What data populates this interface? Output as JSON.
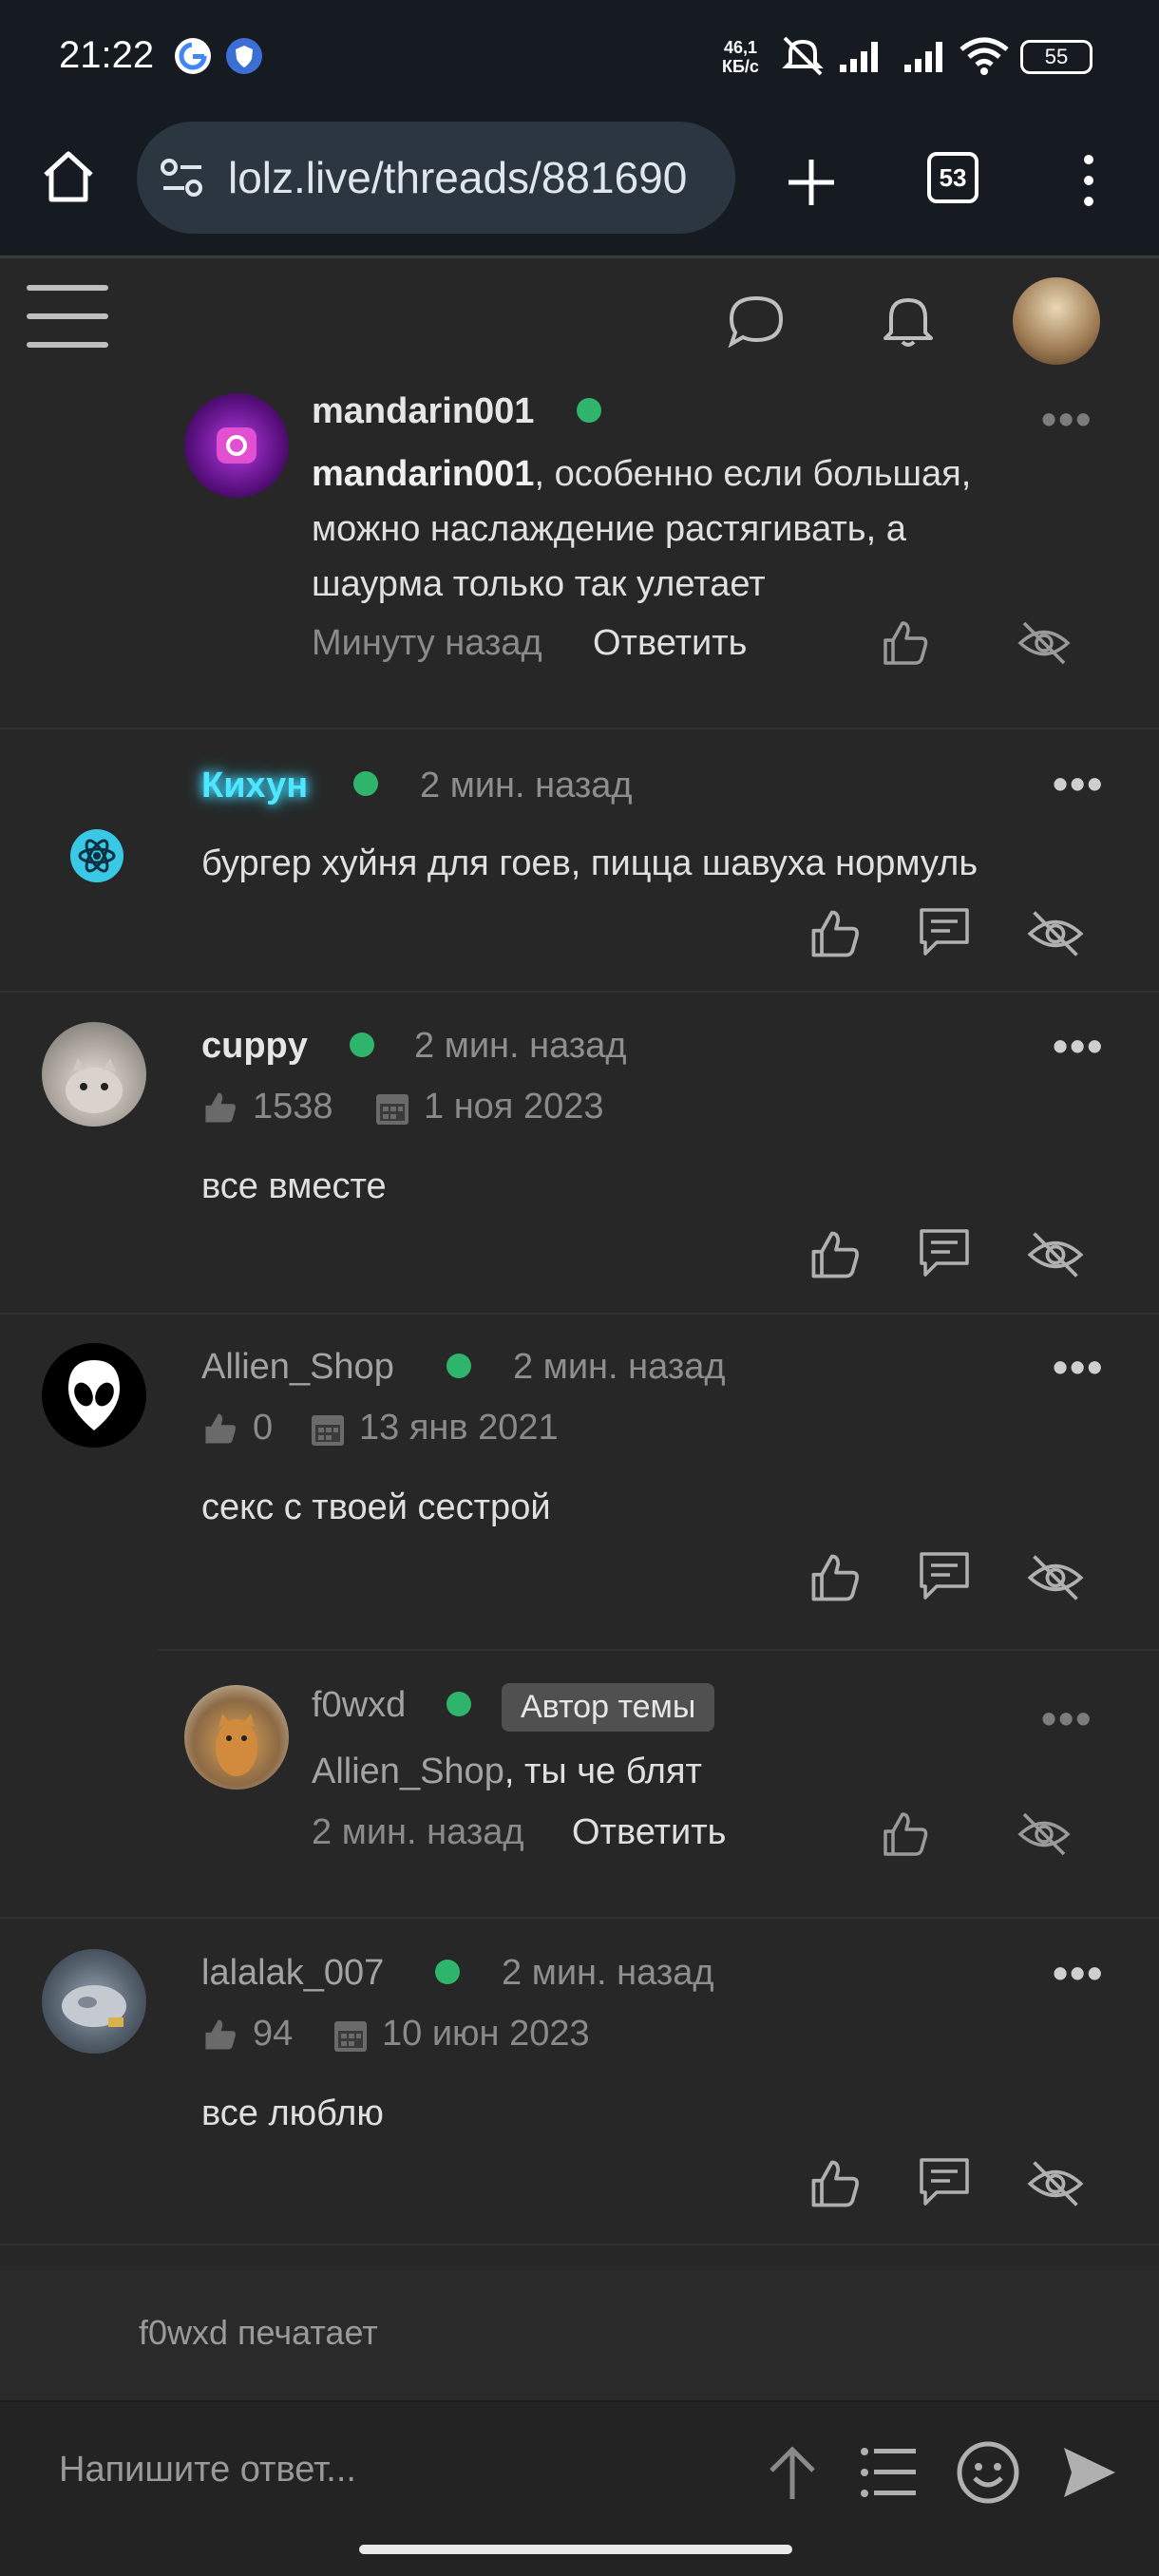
{
  "status_bar": {
    "time": "21:22",
    "net_speed_value": "46,1",
    "net_speed_unit": "КБ/с",
    "battery": "55"
  },
  "browser": {
    "url": "lolz.live/threads/881690",
    "tab_count": "53"
  },
  "comments": [
    {
      "username": "mandarin001",
      "mention": "mandarin001",
      "text_line1": ", особенно если большая,",
      "text_line2": "можно наслаждение растягивать, а",
      "text_line3": "шаурма только так улетает",
      "time": "Минуту назад",
      "reply_label": "Ответить"
    },
    {
      "username": "Кихун",
      "time": "2 мин. назад",
      "text": "бургер хуйня для гоев, пицца шавуха нормуль"
    },
    {
      "username": "cuppy",
      "time": "2 мин. назад",
      "likes": "1538",
      "joined": "1 ноя 2023",
      "text": "все вместе"
    },
    {
      "username": "Allien_Shop",
      "time": "2 мин. назад",
      "likes": "0",
      "joined": "13 янв 2021",
      "text": "секс с твоей сестрой"
    },
    {
      "username": "f0wxd",
      "badge": "Автор темы",
      "mention": "Allien_Shop",
      "text": ", ты че блят",
      "time": "2 мин. назад",
      "reply_label": "Ответить"
    },
    {
      "username": "lalalak_007",
      "time": "2 мин. назад",
      "likes": "94",
      "joined": "10 июн 2023",
      "text": "все люблю"
    }
  ],
  "typing_indicator": "f0wxd печатает",
  "composer": {
    "placeholder": "Напишите ответ..."
  },
  "colors": {
    "online_dot": "#2fb56b",
    "username_glow": "#3fd8ff",
    "background": "#272727"
  },
  "more_label": "•••"
}
